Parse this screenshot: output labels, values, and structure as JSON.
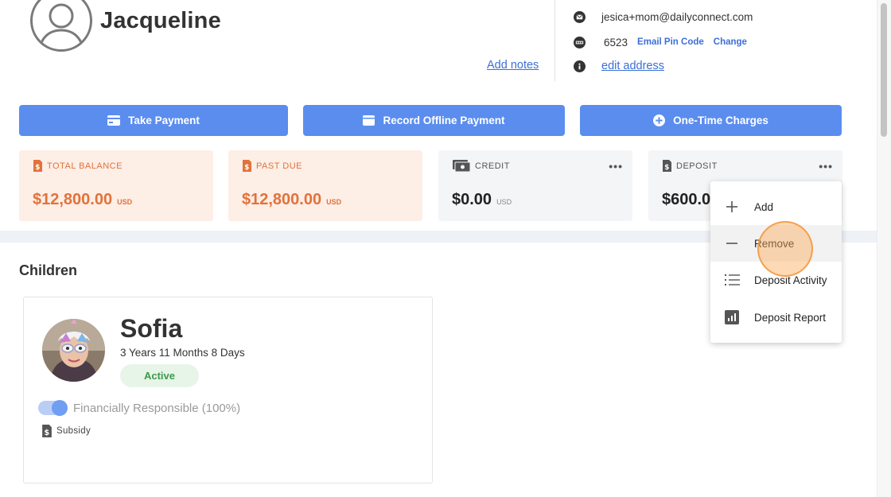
{
  "parent": {
    "name": "Jacqueline",
    "add_notes": "Add notes"
  },
  "contact": {
    "email": "jesica+mom@dailyconnect.com",
    "pin": "6523",
    "email_pin_link": "Email Pin Code",
    "change_link": "Change",
    "edit_address": "edit address"
  },
  "actions": {
    "take_payment": "Take Payment",
    "record_offline": "Record Offline Payment",
    "one_time_charges": "One-Time Charges"
  },
  "balances": [
    {
      "label": "TOTAL BALANCE",
      "amount": "$12,800.00",
      "currency": "USD"
    },
    {
      "label": "PAST DUE",
      "amount": "$12,800.00",
      "currency": "USD"
    },
    {
      "label": "CREDIT",
      "amount": "$0.00",
      "currency": "USD"
    },
    {
      "label": "DEPOSIT",
      "amount": "$600.0"
    }
  ],
  "children_section": {
    "title": "Children"
  },
  "child": {
    "name": "Sofia",
    "age": "3 Years 11 Months 8 Days",
    "status": "Active",
    "financial": "Financially Responsible (100%)",
    "subsidy": "Subsidy"
  },
  "deposit_menu": {
    "items": [
      "Add",
      "Remove",
      "Deposit Activity",
      "Deposit Report"
    ]
  },
  "colors": {
    "primary": "#5b8def",
    "accent_orange": "#e2723a",
    "link": "#3b6fd8",
    "active_green": "#3d9a4a"
  }
}
